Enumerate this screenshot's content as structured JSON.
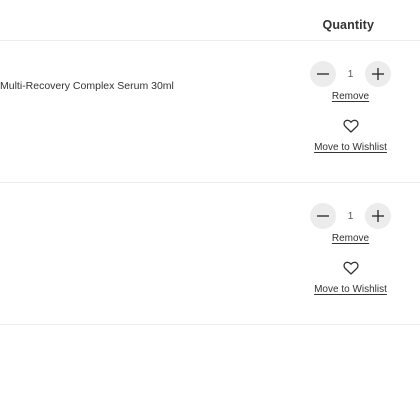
{
  "cart": {
    "quantity_header": "Quantity",
    "items": [
      {
        "name": "Multi-Recovery Complex Serum 30ml",
        "quantity": "1",
        "remove_label": "Remove",
        "wishlist_label": "Move to Wishlist"
      },
      {
        "name": "",
        "quantity": "1",
        "remove_label": "Remove",
        "wishlist_label": "Move to Wishlist"
      }
    ]
  },
  "icons": {
    "decrease": "minus-icon",
    "increase": "plus-icon",
    "wishlist": "heart-icon"
  }
}
